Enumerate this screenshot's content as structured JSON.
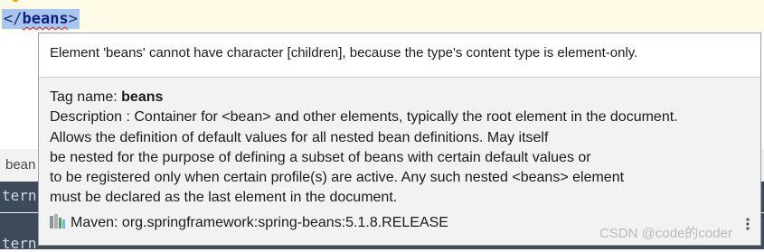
{
  "editor": {
    "tag_open": "</",
    "tag_name": "beans",
    "tag_close": ">",
    "bulb_icon": "lightbulb-icon"
  },
  "bottom_panel": {
    "label": "bean",
    "terminal_lines": [
      "tern",
      "tern"
    ]
  },
  "popup": {
    "error_message": "Element 'beans' cannot have character [children], because the type's content type is element-only.",
    "tag_name_label": "Tag name: ",
    "tag_name_value": "beans",
    "description_lines": [
      "Description : Container for <bean> and other elements, typically the root element in the document.",
      "Allows the definition of default values for all nested bean definitions. May itself",
      "be nested for the purpose of defining a subset of beans with certain default values or",
      "to be registered only when certain profile(s) are active. Any such nested <beans> element",
      "must be declared as the last element in the document."
    ],
    "maven_text": "Maven: org.springframework:spring-beans:5.1.8.RELEASE",
    "maven_icon": "library-icon",
    "more_icon": "more-vertical-icon"
  },
  "watermark": "CSDN @code的coder"
}
